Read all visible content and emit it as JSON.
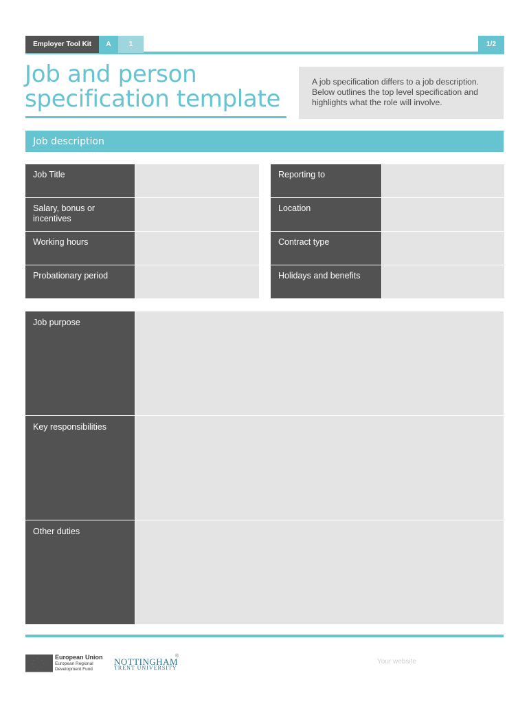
{
  "header": {
    "kit_label": "Employer Tool Kit",
    "section_letter": "A",
    "section_number": "1",
    "page_indicator": "1/2"
  },
  "title": {
    "line1": "Job and person",
    "line2": "specification template"
  },
  "intro": {
    "text": "A job specification differs to a job description. Below outlines the top level specification and highlights what the role will involve."
  },
  "section": {
    "title": "Job description"
  },
  "fields_left": [
    {
      "label": "Job Title",
      "value": ""
    },
    {
      "label": "Salary, bonus or incentives",
      "value": ""
    },
    {
      "label": "Working hours",
      "value": ""
    },
    {
      "label": "Probationary period",
      "value": ""
    }
  ],
  "fields_right": [
    {
      "label": "Reporting to",
      "value": ""
    },
    {
      "label": "Location",
      "value": ""
    },
    {
      "label": "Contract type",
      "value": ""
    },
    {
      "label": "Holidays and benefits",
      "value": ""
    }
  ],
  "large_fields": [
    {
      "label": "Job purpose",
      "value": ""
    },
    {
      "label": "Key responsibilities",
      "value": ""
    },
    {
      "label": "Other duties",
      "value": ""
    }
  ],
  "footer": {
    "eu_title": "European Union",
    "eu_subtitle": "European Regional Development Fund",
    "ntu_line1": "NOTTINGHAM",
    "ntu_reg": "®",
    "ntu_line2": "TRENT UNIVERSITY",
    "website_placeholder": "Your website"
  },
  "colors": {
    "accent": "#66c3d0",
    "label_bg": "#525252",
    "field_bg": "#e4e4e4"
  }
}
